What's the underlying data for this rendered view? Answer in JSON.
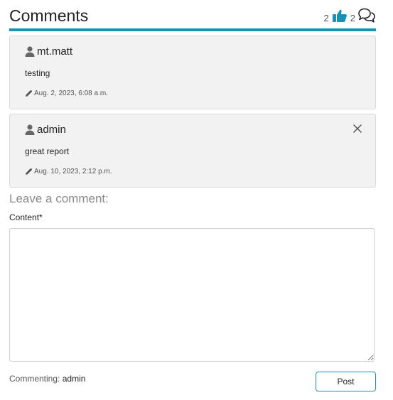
{
  "header": {
    "title": "Comments",
    "like_count": "2",
    "comment_count": "2",
    "like_icon": "thumbs-up-icon",
    "comments_icon": "speech-bubbles-icon"
  },
  "comments": [
    {
      "author": "mt.matt",
      "text": "testing",
      "timestamp": "Aug. 2, 2023, 6:08 a.m.",
      "deletable": false
    },
    {
      "author": "admin",
      "text": "great report",
      "timestamp": "Aug. 10, 2023, 2:12 p.m.",
      "deletable": true
    }
  ],
  "form": {
    "heading": "Leave a comment:",
    "content_label": "Content*",
    "content_value": "",
    "commenting_label": "Commenting:",
    "commenting_user": "admin",
    "post_label": "Post"
  },
  "colors": {
    "accent": "#1493b7",
    "card_background": "#f2f2f2",
    "card_border": "#d9d9d9"
  }
}
